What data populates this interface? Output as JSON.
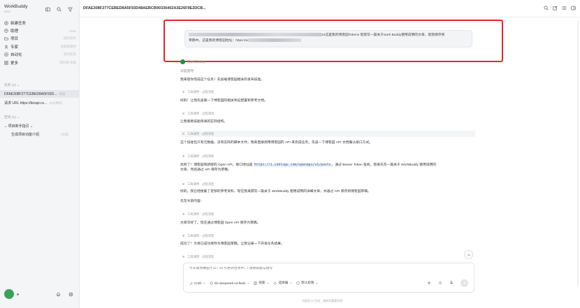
{
  "app": {
    "name": "WorkBuddy",
    "version": "v0.2"
  },
  "sidebar": {
    "nav": [
      {
        "label": "新建任务",
        "hint": "",
        "icon": "plus-circle-icon"
      },
      {
        "label": "助理",
        "hint": "Claw",
        "icon": "assistant-icon"
      },
      {
        "label": "项目",
        "hint": "团队协作",
        "icon": "folder-icon"
      },
      {
        "label": "专家",
        "hint": "首款助理体",
        "icon": "expert-icon"
      },
      {
        "label": "自动化",
        "hint": "定时任务",
        "icon": "automation-icon"
      },
      {
        "label": "更多",
        "hint": "资料库·技能",
        "icon": "grid-icon"
      }
    ],
    "tasks_header": "任务 (2) ⌄",
    "tasks": [
      {
        "title": "DFAE308F277CEBED8A5F93D...",
        "hint": "刚刚",
        "active": true
      },
      {
        "title": "请求 URL https://bizapi.cs...",
        "hint": "22分钟前",
        "active": false
      }
    ],
    "projects_header": "空间 (1) ⌄",
    "tree": [
      {
        "title": "⌄ 项目新手指引 ⌄",
        "hint": ""
      },
      {
        "title": "生成项目功能介绍",
        "hint": "7天前"
      }
    ]
  },
  "header": {
    "title": "DFAE308F277CEBED8A5F93D48AEBCB90336402A3E26F9E2DCB..."
  },
  "user_message": {
    "line1_suffix": "22这是我的博客园Tokens 帮我写一篇关于work Buddy使用说明的文章，帮我保存到",
    "line2_prefix": "草稿中。这是我的博客园地址：https://w"
  },
  "bot": {
    "name": "WorkBuddy"
  },
  "messages": {
    "think_label": "深度思考",
    "m1": "我来帮你完成这个任务！先加载博客园相关的发布技能。",
    "tool_label": "工具调用 · 过程消息",
    "m2": "好的！让我先查看一下博客园的相关凭证配置和参考文档。",
    "m3": "让我看看技能目录的实际结构。",
    "m4": "这个技能包只有元数据，没有实际的脚本文件。我来直接调用博客园的 API 来完成任务。先读一下博客园 API 文档确认接口方式。",
    "m5a": "找到了！博客园有新版的 Open API。接口地址是",
    "m5code": "https://i.cnblogs.com/openapi/v1/posts",
    "m5b": "，通过 Bearer Token 鉴权。我来先写一篇关于 WorkBuddy 使用说明的",
    "m5c": "文章，然后通过 API 保存为草稿。",
    "m6": "好的，我已经搜集了足够的参考资料。现在我来撰写一篇关于 WorkBuddy 使用说明的详细文章，并通过 API 保存到博客园草稿。",
    "m7": "先写文章内容：",
    "m8": "文章写好了。现在通过博客园 Open API 保存为草稿。",
    "m9": "成功了！文章已成功保存为博客园草稿。让我记录一下开发任务结果。"
  },
  "input": {
    "placeholder": "今天帮你做些什么？@ 引用对话文件，/ 调用技能与指令",
    "craft": "Craft",
    "model": "Dz-deepseek-v4-flash",
    "skills": "技能",
    "selector": "选择器",
    "auto": "默认权限"
  },
  "footer": {
    "disclaimer": "内容由 AI 生成，请核实重要信息"
  }
}
